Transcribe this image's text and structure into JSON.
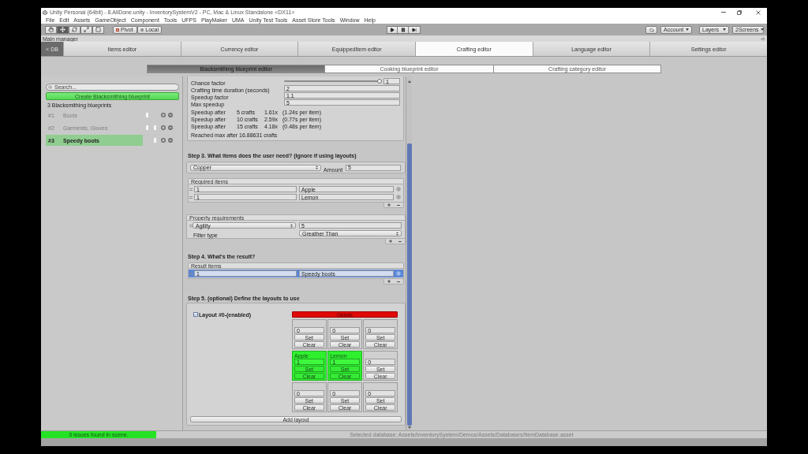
{
  "window": {
    "title": "Unity Personal (64bit) - 8.AllDone.unity - InventorySystemV2 - PC, Mac & Linux Standalone <DX11>"
  },
  "menu": [
    "File",
    "Edit",
    "Assets",
    "GameObject",
    "Component",
    "Tools",
    "UFPS",
    "PlayMaker",
    "UMA",
    "Unity Test Tools",
    "Asset Store Tools",
    "Window",
    "Help"
  ],
  "toolbar": {
    "tools": [
      {
        "kind": "hand",
        "selected": false
      },
      {
        "kind": "move",
        "selected": true
      },
      {
        "kind": "rotate",
        "selected": false
      },
      {
        "kind": "scale",
        "selected": false
      },
      {
        "kind": "rect",
        "selected": false
      }
    ],
    "pivot": "Pivot",
    "space": "Local",
    "account": "Account",
    "layers": "Layers",
    "layout": "2Screens"
  },
  "main_manager": {
    "title": "Main manager",
    "back": "< DB",
    "tabs": [
      {
        "label": "Items editor",
        "selected": false
      },
      {
        "label": "Currency editor",
        "selected": false
      },
      {
        "label": "EquippedItem editor",
        "selected": false
      },
      {
        "label": "Crafting editor",
        "selected": true
      },
      {
        "label": "Language editor",
        "selected": false
      },
      {
        "label": "Settings editor",
        "selected": false
      }
    ]
  },
  "subtabs": [
    {
      "label": "Blacksmithing blueprint editor",
      "selected": true
    },
    {
      "label": "Cooking blueprint editor",
      "selected": false
    },
    {
      "label": "Crafting category editor",
      "selected": false
    }
  ],
  "sidebar": {
    "search": {
      "placeholder": "Search..."
    },
    "create_button": "Create Blacksmithing blueprint",
    "count": "3 Blacksmithing blueprints",
    "items": [
      {
        "index": "#1",
        "name": "Boots",
        "selected": false,
        "marker_1": true,
        "marker_2": false
      },
      {
        "index": "#2",
        "name": "Garments, Gloves",
        "selected": false,
        "marker_1": true,
        "marker_2": true
      },
      {
        "index": "#3",
        "name": "Speedy boots",
        "selected": true,
        "marker_1": false,
        "marker_2": true
      }
    ]
  },
  "editor": {
    "fields": [
      {
        "kind": "slider",
        "label": "Chance factor",
        "level": 1,
        "value": "1"
      },
      {
        "kind": "text",
        "label": "Crafting time duration (seconds)",
        "value": "2"
      },
      {
        "kind": "text",
        "label": "Speedup factor",
        "value": "1.1"
      },
      {
        "kind": "text",
        "label": "Max speedup",
        "value": "5"
      }
    ],
    "speedup_rows": [
      {
        "label": "Speedup after",
        "crafts": "5 crafts",
        "factor": "1.61x",
        "per_item": "(1.24s per item)"
      },
      {
        "label": "Speedup after",
        "crafts": "10 crafts",
        "factor": "2.59x",
        "per_item": "(0.77s per item)"
      },
      {
        "label": "Speedup after",
        "crafts": "15 crafts",
        "factor": "4.18x",
        "per_item": "(0.48s per item)"
      }
    ],
    "reached": "Reached max after 16.88631 crafts"
  },
  "step3": {
    "title": "Step 3. What items does the user need? (Ignore if using layouts)",
    "currency": "Copper",
    "amount_label": "Amount",
    "amount": "5",
    "required_items": {
      "title": "Required items",
      "rows": [
        {
          "amount": "1",
          "item": "Apple"
        },
        {
          "amount": "1",
          "item": "Lemon"
        }
      ]
    },
    "property_requirements": {
      "title": "Property requirements",
      "property": "Agility",
      "value": "5",
      "filter_label": "Filter type",
      "filter": "Greather Than"
    }
  },
  "step4": {
    "title": "Step 4. What's the result?",
    "result_items": {
      "title": "Result items",
      "rows": [
        {
          "amount": "1",
          "item": "Speedy boots",
          "selected": true
        }
      ]
    }
  },
  "step5": {
    "title": "Step 5. (optional) Define the layouts to use",
    "layouts": [
      {
        "label": "Layout #0-(enabled)",
        "checked": true,
        "delete": "Delete",
        "cells": [
          {
            "filled": false,
            "amount": "0",
            "set": "Set",
            "clear": "Clear"
          },
          {
            "filled": false,
            "amount": "0",
            "set": "Set",
            "clear": "Clear"
          },
          {
            "filled": false,
            "amount": "0",
            "set": "Set",
            "clear": "Clear"
          },
          {
            "filled": true,
            "item": "Apple",
            "amount": "1",
            "set": "Set",
            "clear": "Clear"
          },
          {
            "filled": true,
            "item": "Lemon",
            "amount": "1",
            "set": "Set",
            "clear": "Clear"
          },
          {
            "filled": false,
            "amount": "0",
            "set": "Set",
            "clear": "Clear"
          },
          {
            "filled": false,
            "amount": "0",
            "set": "Set",
            "clear": "Clear"
          },
          {
            "filled": false,
            "amount": "0",
            "set": "Set",
            "clear": "Clear"
          },
          {
            "filled": false,
            "amount": "0",
            "set": "Set",
            "clear": "Clear"
          }
        ]
      }
    ],
    "add_button": "Add layout"
  },
  "status_bar": {
    "issues": "0 issues found in scene.",
    "database": "Selected database: Assets/InventorySystem/Demos/Assets/Databases/ItemDatabase.asset"
  }
}
